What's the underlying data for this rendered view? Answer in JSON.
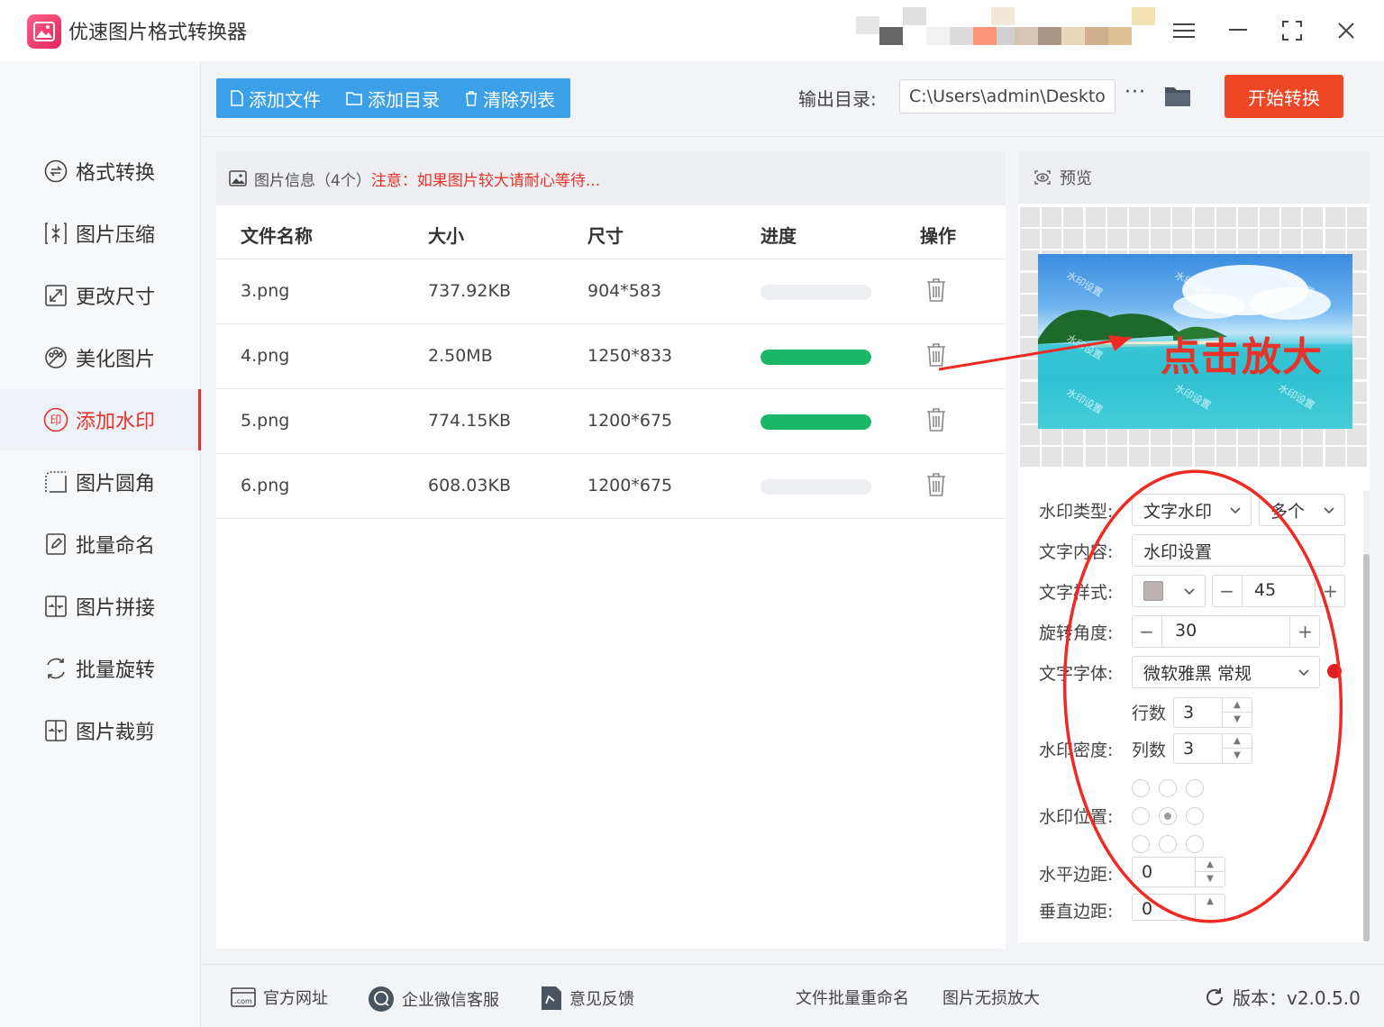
{
  "app": {
    "title": "优速图片格式转换器"
  },
  "sidebar": {
    "items": [
      {
        "label": "格式转换",
        "icon": "swap-circle-icon"
      },
      {
        "label": "图片压缩",
        "icon": "compress-icon"
      },
      {
        "label": "更改尺寸",
        "icon": "resize-icon"
      },
      {
        "label": "美化图片",
        "icon": "palette-icon"
      },
      {
        "label": "添加水印",
        "icon": "watermark-icon",
        "active": true
      },
      {
        "label": "图片圆角",
        "icon": "round-corner-icon"
      },
      {
        "label": "批量命名",
        "icon": "rename-icon"
      },
      {
        "label": "图片拼接",
        "icon": "join-icon"
      },
      {
        "label": "批量旋转",
        "icon": "rotate-icon"
      },
      {
        "label": "图片裁剪",
        "icon": "crop-icon"
      }
    ]
  },
  "toolbar": {
    "add_file": "添加文件",
    "add_dir": "添加目录",
    "clear_list": "清除列表",
    "output_label": "输出目录:",
    "output_path": "C:\\Users\\admin\\Deskto",
    "more": "···",
    "start": "开始转换"
  },
  "list": {
    "header_info": "图片信息（4个）",
    "header_warn": "注意：如果图片较大请耐心等待...",
    "columns": [
      "文件名称",
      "大小",
      "尺寸",
      "进度",
      "操作"
    ],
    "rows": [
      {
        "name": "3.png",
        "size": "737.92KB",
        "dims": "904*583",
        "progress": 0
      },
      {
        "name": "4.png",
        "size": "2.50MB",
        "dims": "1250*833",
        "progress": 100
      },
      {
        "name": "5.png",
        "size": "774.15KB",
        "dims": "1200*675",
        "progress": 100
      },
      {
        "name": "6.png",
        "size": "608.03KB",
        "dims": "1200*675",
        "progress": 0
      }
    ]
  },
  "preview": {
    "title": "预览",
    "watermark_text": "水印设置",
    "annotation": "点击放大"
  },
  "settings": {
    "type_label": "水印类型:",
    "type_value": "文字水印",
    "count_value": "多个",
    "content_label": "文字内容:",
    "content_value": "水印设置",
    "style_label": "文字样式:",
    "font_size": "45",
    "rotate_label": "旋转角度:",
    "rotate_value": "30",
    "rotate_unit": "°",
    "font_label": "文字字体:",
    "font_value": "微软雅黑 常规",
    "rows_label": "行数",
    "rows_value": "3",
    "density_label": "水印密度:",
    "cols_label": "列数",
    "cols_value": "3",
    "position_label": "水印位置:",
    "hmargin_label": "水平边距:",
    "hmargin_value": "0",
    "vmargin_label": "垂直边距:",
    "vmargin_value": "0"
  },
  "footer": {
    "website": "官方网址",
    "wechat": "企业微信客服",
    "feedback": "意见反馈",
    "batch_rename": "文件批量重命名",
    "lossless": "图片无损放大",
    "version": "版本：v2.0.5.0"
  },
  "colors": {
    "accent": "#3ca0e8",
    "danger": "#e5332a",
    "start": "#ef4726",
    "progress": "#1ab866"
  }
}
